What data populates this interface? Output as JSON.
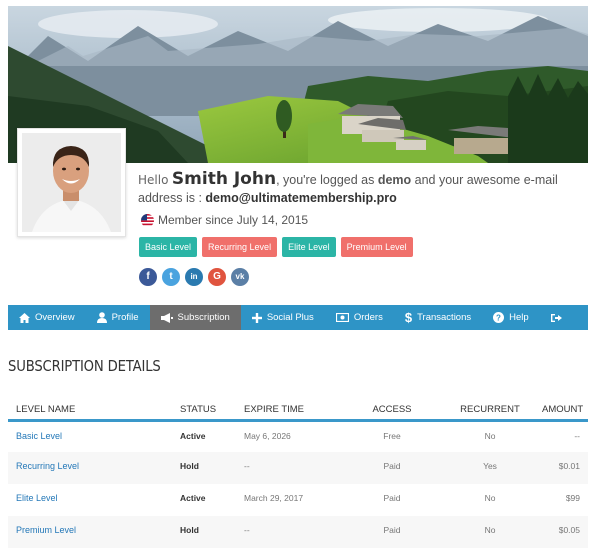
{
  "profile": {
    "hello": "Hello",
    "name": "Smith John",
    "logged_as_pre": ", you're logged as ",
    "demo_word": "demo",
    "logged_as_post": " and your awesome e-mail address is : ",
    "email": "demo@ultimatemembership.pro",
    "member_since": "Member since July 14, 2015",
    "flag": "us-flag-icon"
  },
  "levels": [
    {
      "label": "Basic Level",
      "color": "#2bb5a6"
    },
    {
      "label": "Recurring Level",
      "color": "#f0706b"
    },
    {
      "label": "Elite Level",
      "color": "#2bb5a6"
    },
    {
      "label": "Premium Level",
      "color": "#f0706b"
    }
  ],
  "socials": [
    {
      "glyph": "f",
      "icon": "facebook-icon",
      "color": "#3b5998"
    },
    {
      "glyph": "t",
      "icon": "twitter-icon",
      "color": "#4aa3df"
    },
    {
      "glyph": "in",
      "icon": "linkedin-icon",
      "color": "#2a7ab0"
    },
    {
      "glyph": "G",
      "icon": "google-icon",
      "color": "#e0543f"
    },
    {
      "glyph": "vk",
      "icon": "vk-icon",
      "color": "#5b7fa6"
    }
  ],
  "nav": {
    "items": [
      {
        "label": "Overview",
        "icon": "home-icon"
      },
      {
        "label": "Profile",
        "icon": "user-icon"
      },
      {
        "label": "Subscription",
        "icon": "megaphone-icon"
      },
      {
        "label": "Social Plus",
        "icon": "plus-icon"
      },
      {
        "label": "Orders",
        "icon": "money-icon"
      },
      {
        "label": "Transactions",
        "icon": "dollar-icon"
      },
      {
        "label": "Help",
        "icon": "help-icon"
      },
      {
        "label": "",
        "icon": "sign-out-icon"
      }
    ],
    "active": "Subscription",
    "bar_color": "#2e94c6"
  },
  "subscriptions": {
    "title": "SUBSCRIPTION DETAILS",
    "columns": [
      "LEVEL NAME",
      "STATUS",
      "EXPIRE TIME",
      "ACCESS",
      "RECURRENT",
      "AMOUNT"
    ],
    "rows": [
      {
        "level": "Basic Level",
        "status": "Active",
        "expire": "May 6, 2026",
        "access": "Free",
        "recurrent": "No",
        "amount": "--"
      },
      {
        "level": "Recurring Level",
        "status": "Hold",
        "expire": "--",
        "access": "Paid",
        "recurrent": "Yes",
        "amount": "$0.01"
      },
      {
        "level": "Elite Level",
        "status": "Active",
        "expire": "March 29, 2017",
        "access": "Paid",
        "recurrent": "No",
        "amount": "$99"
      },
      {
        "level": "Premium Level",
        "status": "Hold",
        "expire": "--",
        "access": "Paid",
        "recurrent": "No",
        "amount": "$0.05"
      }
    ]
  }
}
